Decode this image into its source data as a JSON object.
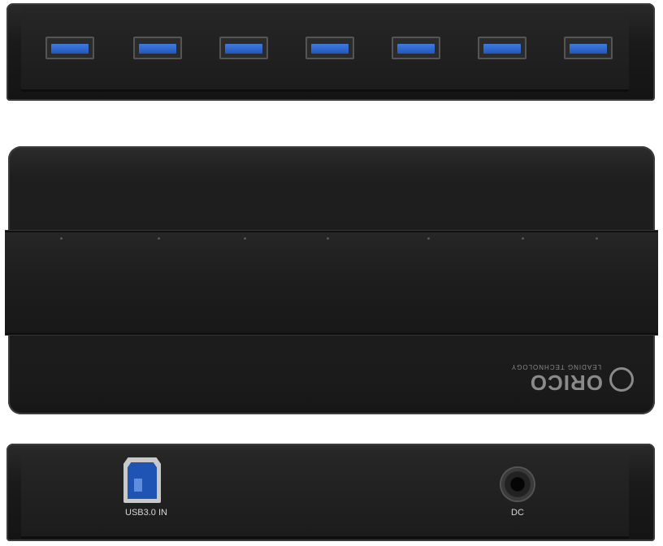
{
  "product": {
    "brand": "ORICO",
    "tagline": "LEADING TECHNOLOGY",
    "usb_ports_count": 7,
    "port_color": "#2f62c8",
    "body_color": "#1c1c1c"
  },
  "back_panel": {
    "usb_in_label": "USB3.0 IN",
    "dc_label": "DC"
  }
}
